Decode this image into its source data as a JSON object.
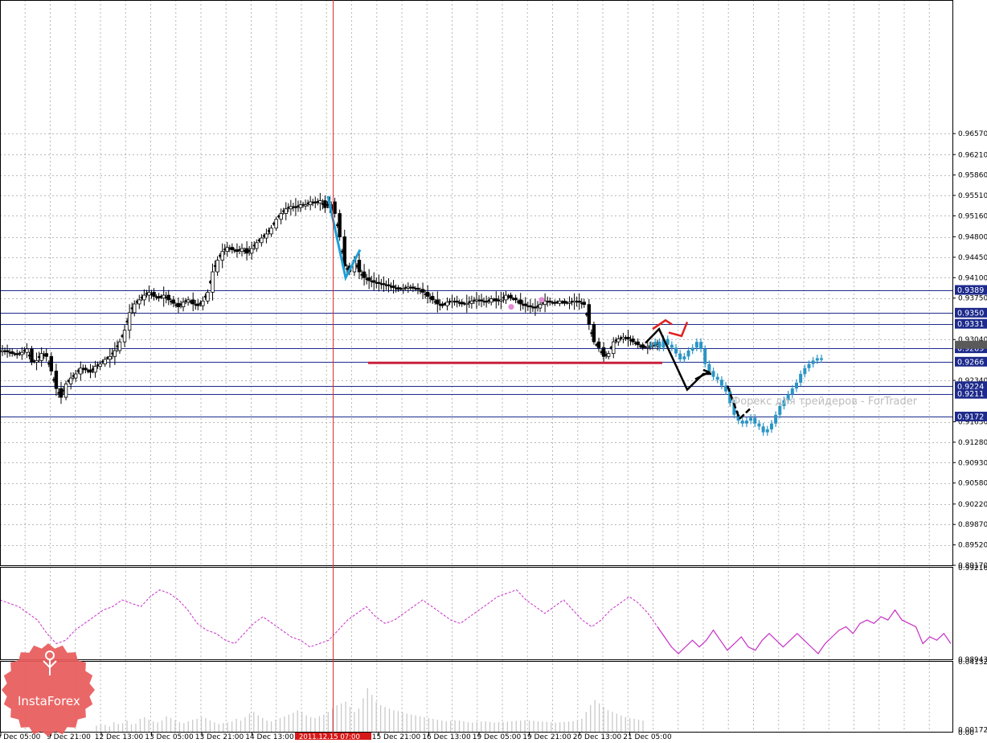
{
  "chart_data": [
    {
      "type": "candlestick",
      "panel": "price",
      "ylim": [
        0.8917,
        0.9886
      ],
      "y_ticks": [
        "0.96570",
        "0.96210",
        "0.95860",
        "0.95510",
        "0.95160",
        "0.94800",
        "0.94450",
        "0.94100",
        "0.93750",
        "0.93040",
        "0.92340",
        "0.91630",
        "0.91280",
        "0.90930",
        "0.90580",
        "0.90220",
        "0.89870",
        "0.89520",
        "0.89170"
      ],
      "x_ticks": [
        "9 Dec 05:00",
        "9 Dec 21:00",
        "12 Dec 13:00",
        "13 Dec 05:00",
        "13 Dec 21:00",
        "14 Dec 13:00",
        "15 Dec 21:00",
        "16 Dec 13:00",
        "19 Dec 05:00",
        "19 Dec 21:00",
        "20 Dec 13:00",
        "21 Dec 05:00"
      ],
      "cursor_time_label": "2011.12.15 07:00",
      "grid": true,
      "levels": [
        {
          "label": "0.9389",
          "value": 0.9389
        },
        {
          "label": "0.9350",
          "value": 0.935
        },
        {
          "label": "0.9331",
          "value": 0.9331
        },
        {
          "label": "0.9289",
          "value": 0.9289
        },
        {
          "label": "0.9266",
          "value": 0.9266
        },
        {
          "label": "0.9224",
          "value": 0.9224
        },
        {
          "label": "0.9211",
          "value": 0.9211
        },
        {
          "label": "0.9172",
          "value": 0.9172
        }
      ],
      "current_price": 0.9295,
      "support_line": {
        "value": 0.9264,
        "color": "#c8203c"
      },
      "trajectory": {
        "historical": [
          0.9285,
          0.9283,
          0.928,
          0.9278,
          0.9282,
          0.9288,
          0.9265,
          0.9268,
          0.928,
          0.9275,
          0.925,
          0.922,
          0.9205,
          0.9228,
          0.9238,
          0.9245,
          0.9255,
          0.9252,
          0.9248,
          0.9258,
          0.9262,
          0.927,
          0.9275,
          0.9285,
          0.93,
          0.932,
          0.935,
          0.9365,
          0.9372,
          0.938,
          0.9385,
          0.9378,
          0.9375,
          0.938,
          0.9372,
          0.9366,
          0.936,
          0.9368,
          0.9372,
          0.9365,
          0.9362,
          0.937,
          0.9385,
          0.942,
          0.944,
          0.9455,
          0.9462,
          0.9458,
          0.9455,
          0.946,
          0.9452,
          0.946,
          0.947,
          0.9478,
          0.9485,
          0.9495,
          0.951,
          0.952,
          0.9528,
          0.9532,
          0.953,
          0.9535,
          0.9535,
          0.954,
          0.9538,
          0.9542,
          0.953,
          0.954,
          0.952,
          0.948,
          0.943,
          0.942,
          0.944,
          0.942,
          0.941,
          0.9405,
          0.9402,
          0.94,
          0.9398,
          0.9396,
          0.9393,
          0.939,
          0.9392,
          0.9394,
          0.9392,
          0.939,
          0.9385,
          0.9378,
          0.9372,
          0.9365,
          0.9362,
          0.9368,
          0.937,
          0.9368,
          0.9365,
          0.9366,
          0.937,
          0.9372,
          0.937,
          0.9368,
          0.9374,
          0.937,
          0.9372,
          0.938,
          0.9375,
          0.9372,
          0.9365,
          0.9362,
          0.936,
          0.9358,
          0.9364,
          0.937,
          0.9368,
          0.9366,
          0.937,
          0.9366,
          0.9368,
          0.937,
          0.9368,
          0.9364,
          0.933,
          0.93,
          0.929,
          0.9275,
          0.928,
          0.93,
          0.9305,
          0.9308,
          0.9305,
          0.93,
          0.9295,
          0.929,
          0.9292,
          0.9294,
          0.9295
        ],
        "forecast": [
          0.9295,
          0.93,
          0.929,
          0.9305,
          0.9295,
          0.929,
          0.928,
          0.927,
          0.9275,
          0.9285,
          0.929,
          0.93,
          0.9288,
          0.9262,
          0.925,
          0.924,
          0.9235,
          0.9225,
          0.9215,
          0.9195,
          0.9175,
          0.9165,
          0.916,
          0.9165,
          0.917,
          0.916,
          0.9155,
          0.9145,
          0.915,
          0.916,
          0.9175,
          0.919,
          0.92,
          0.921,
          0.922,
          0.923,
          0.9245,
          0.9255,
          0.9262,
          0.9268,
          0.9272,
          0.927
        ]
      },
      "zigzag_pattern": [
        {
          "t": 0.947,
          "v": 0.955,
          "color": "blue"
        },
        {
          "t": 0.495,
          "v": 0.941,
          "color": "blue"
        },
        {
          "t": 0.521,
          "v": 0.9455,
          "color": "blue"
        },
        {
          "t": 1.0,
          "v": 0.9298,
          "color": "black"
        },
        {
          "t": 1.084,
          "v": 0.9322,
          "color": "black"
        },
        {
          "t": 1.204,
          "v": 0.9218,
          "color": "black"
        },
        {
          "t": 1.284,
          "v": 0.9245,
          "color": "black"
        },
        {
          "t": 1.245,
          "v": 0.9232,
          "color": "black"
        },
        {
          "t": 1.22,
          "v": 0.9226,
          "color": "black"
        },
        {
          "t": 1.383,
          "v": 0.9218,
          "color": "black"
        },
        {
          "t": 1.42,
          "v": 0.9168,
          "color": "black"
        },
        {
          "t": 1.455,
          "v": 0.918,
          "color": "black"
        }
      ],
      "red_pattern": [
        {
          "t": 1.005,
          "v": 0.9322
        },
        {
          "t": 1.04,
          "v": 0.9336
        },
        {
          "t": 1.075,
          "v": 0.933
        },
        {
          "t": 1.105,
          "v": 0.9318
        },
        {
          "t": 1.14,
          "v": 0.9316
        },
        {
          "t": 1.155,
          "v": 0.9336
        }
      ],
      "colors": {
        "candle": "#000000",
        "forecast": "#2a95c6",
        "levels": "#1d2a8c",
        "zigzag_blue": "#1e9fd8",
        "cursor": "#d83030"
      }
    },
    {
      "type": "line",
      "panel": "indicator",
      "ylim": [
        0.98943,
        0.99216
      ],
      "y_ticks": [
        "0.99216",
        "0.98943"
      ],
      "historical": [
        0.9912,
        0.9911,
        0.991,
        0.9908,
        0.9906,
        0.9902,
        0.9899,
        0.99,
        0.9903,
        0.9905,
        0.9907,
        0.9909,
        0.991,
        0.9912,
        0.9911,
        0.991,
        0.9913,
        0.9915,
        0.9914,
        0.9912,
        0.9909,
        0.9905,
        0.9903,
        0.9902,
        0.99,
        0.9899,
        0.9902,
        0.9905,
        0.9907,
        0.9905,
        0.9903,
        0.9901,
        0.99,
        0.9898,
        0.9899,
        0.99,
        0.9903,
        0.9906,
        0.9908,
        0.991,
        0.9907,
        0.9905,
        0.9906,
        0.9908,
        0.991,
        0.9912,
        0.991,
        0.9908,
        0.9906,
        0.9905,
        0.9907,
        0.9909,
        0.9911,
        0.9913,
        0.9914,
        0.9915,
        0.9912,
        0.991,
        0.9908,
        0.991,
        0.9912,
        0.9909,
        0.9906,
        0.9904,
        0.9906,
        0.9909,
        0.9911,
        0.9913,
        0.9911,
        0.9908,
        0.9904
      ],
      "solid": [
        0.9904,
        0.9901,
        0.9898,
        0.9896,
        0.9898,
        0.99,
        0.9898,
        0.99,
        0.9903,
        0.99,
        0.9897,
        0.9899,
        0.9901,
        0.9898,
        0.9897,
        0.99,
        0.9902,
        0.99,
        0.9898,
        0.99,
        0.9902,
        0.99,
        0.9898,
        0.9896,
        0.9899,
        0.9901,
        0.9903,
        0.9904,
        0.9902,
        0.9905,
        0.9906,
        0.9905,
        0.9907,
        0.9906,
        0.9909,
        0.9906,
        0.9905,
        0.9904,
        0.9899,
        0.9901,
        0.99,
        0.9902,
        0.9899
      ],
      "colors": {
        "line": "#c82ec8"
      }
    },
    {
      "type": "bar",
      "panel": "volume",
      "ylim": [
        0,
        0.04132
      ],
      "y_ticks": [
        "0.04132",
        "0.00172",
        "0.00"
      ],
      "values": [
        0.004,
        0.005,
        0.0045,
        0.0035,
        0.006,
        0.005,
        0.0055,
        0.007,
        0.0048,
        0.0052,
        0.008,
        0.009,
        0.0075,
        0.0065,
        0.006,
        0.007,
        0.0095,
        0.0085,
        0.007,
        0.006,
        0.0055,
        0.0065,
        0.0075,
        0.008,
        0.009,
        0.0085,
        0.007,
        0.006,
        0.005,
        0.0055,
        0.006,
        0.0065,
        0.008,
        0.007,
        0.009,
        0.011,
        0.012,
        0.01,
        0.0085,
        0.007,
        0.0065,
        0.0075,
        0.0085,
        0.0095,
        0.0105,
        0.0115,
        0.013,
        0.012,
        0.01,
        0.009,
        0.0085,
        0.0095,
        0.0105,
        0.012,
        0.014,
        0.016,
        0.017,
        0.018,
        0.015,
        0.012,
        0.014,
        0.02,
        0.026,
        0.022,
        0.018,
        0.016,
        0.015,
        0.014,
        0.013,
        0.0125,
        0.012,
        0.011,
        0.0105,
        0.01,
        0.0095,
        0.009,
        0.0085,
        0.008,
        0.0075,
        0.007,
        0.0065,
        0.0068,
        0.0072,
        0.007,
        0.0066,
        0.006,
        0.0058,
        0.0062,
        0.0064,
        0.0066,
        0.0062,
        0.0058,
        0.006,
        0.0062,
        0.0064,
        0.0066,
        0.0068,
        0.007,
        0.0072,
        0.007,
        0.0068,
        0.0066,
        0.0064,
        0.0062,
        0.006,
        0.0058,
        0.006,
        0.0062,
        0.0064,
        0.0066,
        0.007,
        0.008,
        0.012,
        0.016,
        0.019,
        0.017,
        0.015,
        0.013,
        0.012,
        0.011,
        0.01,
        0.009,
        0.0085,
        0.008,
        0.0075,
        0.007
      ],
      "colors": {
        "bar": "#c9c9c9"
      }
    }
  ],
  "watermark": "Форекс для трейдеров - ForTrader",
  "logo": {
    "text": "InstaForex",
    "color": "#e85a5a"
  }
}
